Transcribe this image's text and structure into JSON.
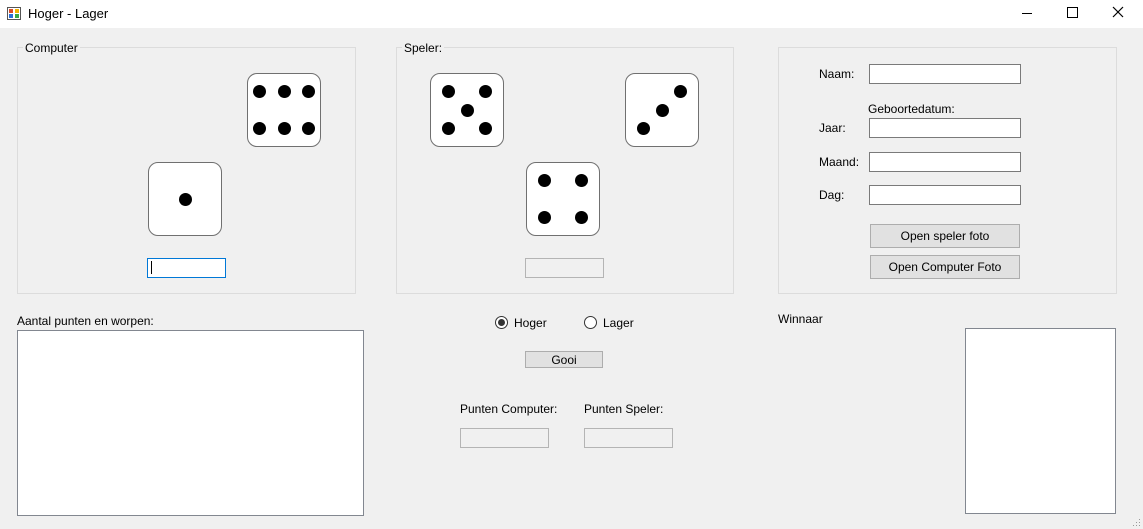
{
  "window": {
    "title": "Hoger - Lager",
    "icon": "app-icon",
    "controls": {
      "minimize": "minimize-icon",
      "maximize": "maximize-icon",
      "close": "close-icon"
    }
  },
  "computer_group": {
    "title": "Computer",
    "dice": [
      6,
      1
    ],
    "total_value": ""
  },
  "speler_group": {
    "title": "Speler:",
    "dice": [
      5,
      3,
      4
    ],
    "total_value": ""
  },
  "player_info": {
    "naam_label": "Naam:",
    "naam_value": "",
    "geboortedatum_label": "Geboortedatum:",
    "jaar_label": "Jaar:",
    "jaar_value": "",
    "maand_label": "Maand:",
    "maand_value": "",
    "dag_label": "Dag:",
    "dag_value": "",
    "open_speler_foto": "Open speler foto",
    "open_computer_foto": "Open Computer Foto"
  },
  "scores": {
    "label": "Aantal punten en worpen:",
    "content": ""
  },
  "controls": {
    "hoger_label": "Hoger",
    "lager_label": "Lager",
    "selected": "hoger",
    "gooi_label": "Gooi",
    "punten_computer_label": "Punten Computer:",
    "punten_computer_value": "",
    "punten_speler_label": "Punten Speler:",
    "punten_speler_value": ""
  },
  "winnaar": {
    "label": "Winnaar"
  }
}
